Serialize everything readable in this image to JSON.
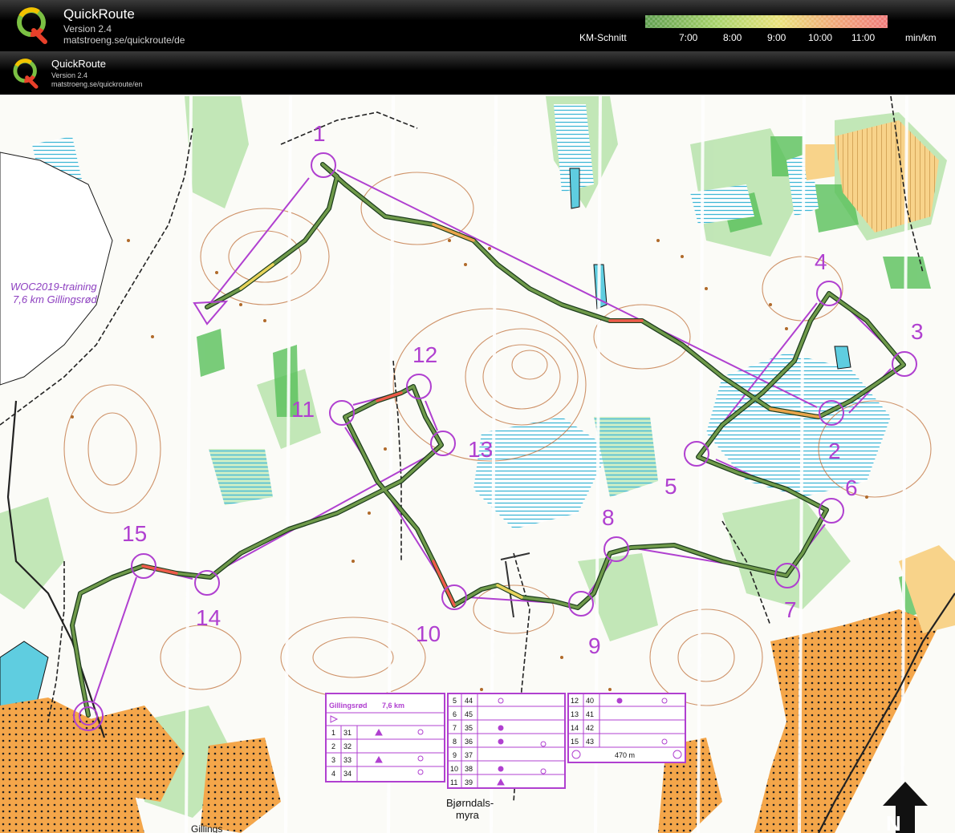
{
  "header": {
    "app_name": "QuickRoute",
    "version": "Version 2.4",
    "url": "matstroeng.se/quickroute/de",
    "legend_label": "KM-Schnitt",
    "scale_ticks": [
      "7:00",
      "8:00",
      "9:00",
      "10:00",
      "11:00"
    ],
    "scale_unit": "min/km",
    "scale_colors": [
      "#6fae58",
      "#a8d36a",
      "#e9e27a",
      "#f0a878",
      "#f07a7a"
    ]
  },
  "subheader": {
    "app_name": "QuickRoute",
    "version": "Version 2.4",
    "url": "matstroeng.se/quickroute/en"
  },
  "map": {
    "title_line1": "WOC2019-training",
    "title_line2": "7,6 km Gillingsrød",
    "controls": [
      "1",
      "2",
      "3",
      "4",
      "5",
      "6",
      "7",
      "8",
      "9",
      "10",
      "11",
      "12",
      "13",
      "14",
      "15"
    ],
    "place_name_1": "Bjørndals-",
    "place_name_2": "myra",
    "place_name_bottom": "Gillings",
    "colors": {
      "course": "#b040d0",
      "route": "#3f7f3a",
      "fast": "#f05050",
      "forest": "#ffffff",
      "open_land": "#f4a64a",
      "green": "#6cc36c",
      "water": "#6fd0df"
    }
  },
  "description": {
    "event": "Gillingsrød",
    "length": "7,6 km",
    "col1": [
      {
        "n": "1",
        "code": "31"
      },
      {
        "n": "2",
        "code": "32"
      },
      {
        "n": "3",
        "code": "33"
      },
      {
        "n": "4",
        "code": "34"
      }
    ],
    "col2": [
      {
        "n": "5",
        "code": "44"
      },
      {
        "n": "6",
        "code": "45"
      },
      {
        "n": "7",
        "code": "35"
      },
      {
        "n": "8",
        "code": "36"
      },
      {
        "n": "9",
        "code": "37"
      },
      {
        "n": "10",
        "code": "38"
      },
      {
        "n": "11",
        "code": "39"
      }
    ],
    "col3": [
      {
        "n": "12",
        "code": "40"
      },
      {
        "n": "13",
        "code": "41"
      },
      {
        "n": "14",
        "code": "42"
      },
      {
        "n": "15",
        "code": "43"
      }
    ],
    "finish_distance": "470 m"
  }
}
